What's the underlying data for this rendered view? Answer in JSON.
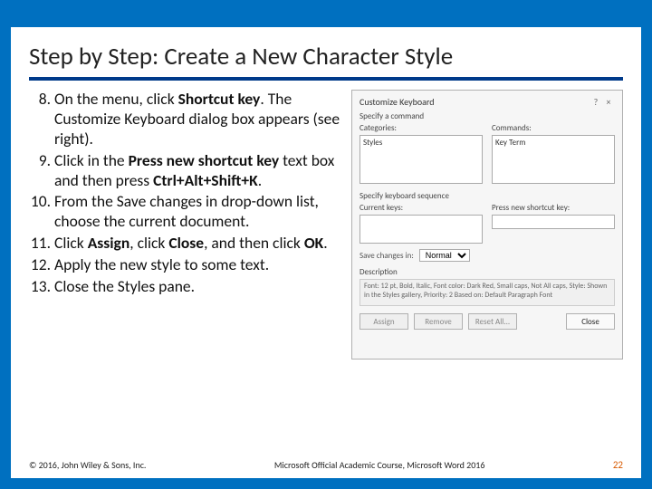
{
  "title": "Step by Step: Create a New Character Style",
  "start_number": 8,
  "steps": [
    {
      "pre": "On the menu, click ",
      "b1": "Shortcut key",
      "post": ". The Customize Keyboard dialog box appears (see right)."
    },
    {
      "pre": "Click in the ",
      "b1": "Press new shortcut key",
      "mid": " text box and then press ",
      "b2": "Ctrl+Alt+Shift+K",
      "post": "."
    },
    {
      "pre": "From the Save changes in drop-down list, choose the current document.",
      "b1": "",
      "post": ""
    },
    {
      "pre": "Click ",
      "b1": "Assign",
      "mid": ", click ",
      "b2": "Close",
      "mid2": ", and then click ",
      "b3": "OK",
      "post": "."
    },
    {
      "pre": "Apply the new style to some text.",
      "b1": "",
      "post": ""
    },
    {
      "pre": "Close the Styles pane.",
      "b1": "",
      "post": ""
    }
  ],
  "dialog": {
    "title": "Customize Keyboard",
    "help": "?",
    "close": "×",
    "specify_cmd": "Specify a command",
    "categories_lbl": "Categories:",
    "categories_val": "Styles",
    "commands_lbl": "Commands:",
    "commands_val": "Key Term",
    "specify_seq": "Specify keyboard sequence",
    "current_lbl": "Current keys:",
    "press_lbl": "Press new shortcut key:",
    "press_val": "",
    "save_lbl": "Save changes in:",
    "save_val": "Normal",
    "desc_lbl": "Description",
    "desc_val": "Font: 12 pt, Bold, Italic, Font color: Dark Red, Small caps, Not All caps, Style: Shown in the Styles gallery, Priority: 2 Based on: Default Paragraph Font",
    "btn_assign": "Assign",
    "btn_remove": "Remove",
    "btn_reset": "Reset All...",
    "btn_close": "Close"
  },
  "footer": {
    "copyright": "© 2016, John Wiley & Sons, Inc.",
    "course": "Microsoft Official Academic Course, Microsoft Word 2016",
    "page": "22"
  }
}
